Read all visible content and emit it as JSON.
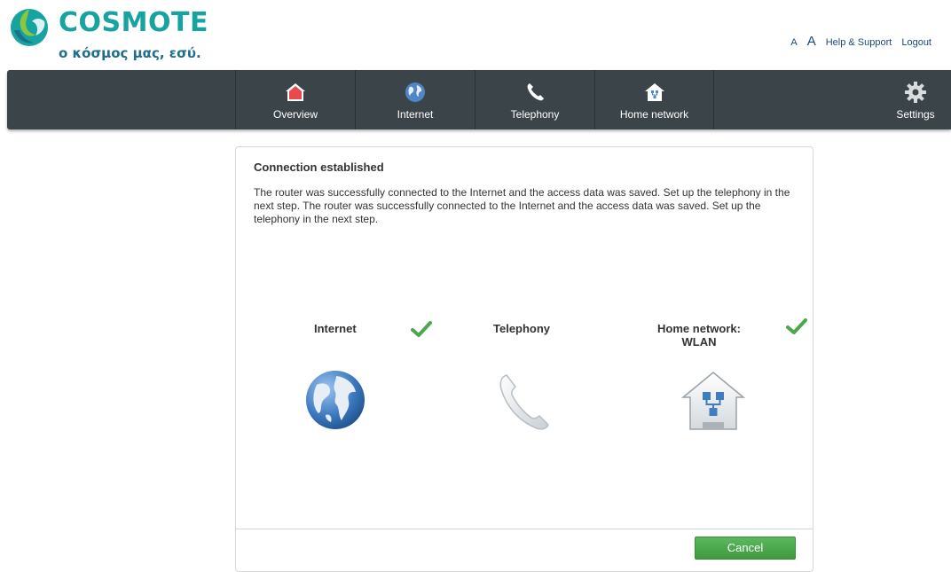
{
  "brand": {
    "name": "COSMOTE",
    "tagline": "ο κόσμος μας, εσύ.",
    "primary_color": "#17a3a0",
    "secondary_color": "#1f6e8a"
  },
  "toplinks": {
    "font_small": "A",
    "font_large": "A",
    "help": "Help & Support",
    "logout": "Logout"
  },
  "nav": {
    "items": [
      {
        "label": "Overview",
        "icon": "home-icon"
      },
      {
        "label": "Internet",
        "icon": "globe-icon"
      },
      {
        "label": "Telephony",
        "icon": "phone-icon"
      },
      {
        "label": "Home network",
        "icon": "home-network-icon"
      }
    ],
    "settings": {
      "label": "Settings",
      "icon": "gear-icon"
    },
    "bar_color": "#3b4448"
  },
  "panel": {
    "title": "Connection established",
    "text": "The router was successfully connected to the Internet and the access data was saved. Set up the telephony in the next step. The router was successfully connected to the Internet and the access data was saved. Set up the telephony in the next step.",
    "steps": [
      {
        "label": "Internet",
        "checked": true,
        "icon": "globe-icon"
      },
      {
        "label": "Telephony",
        "checked": false,
        "icon": "phone-icon"
      },
      {
        "label_line1": "Home network:",
        "label_line2": "WLAN",
        "checked": true,
        "icon": "home-network-icon"
      }
    ],
    "cancel_label": "Cancel",
    "accent_green": "#4aa84a"
  }
}
